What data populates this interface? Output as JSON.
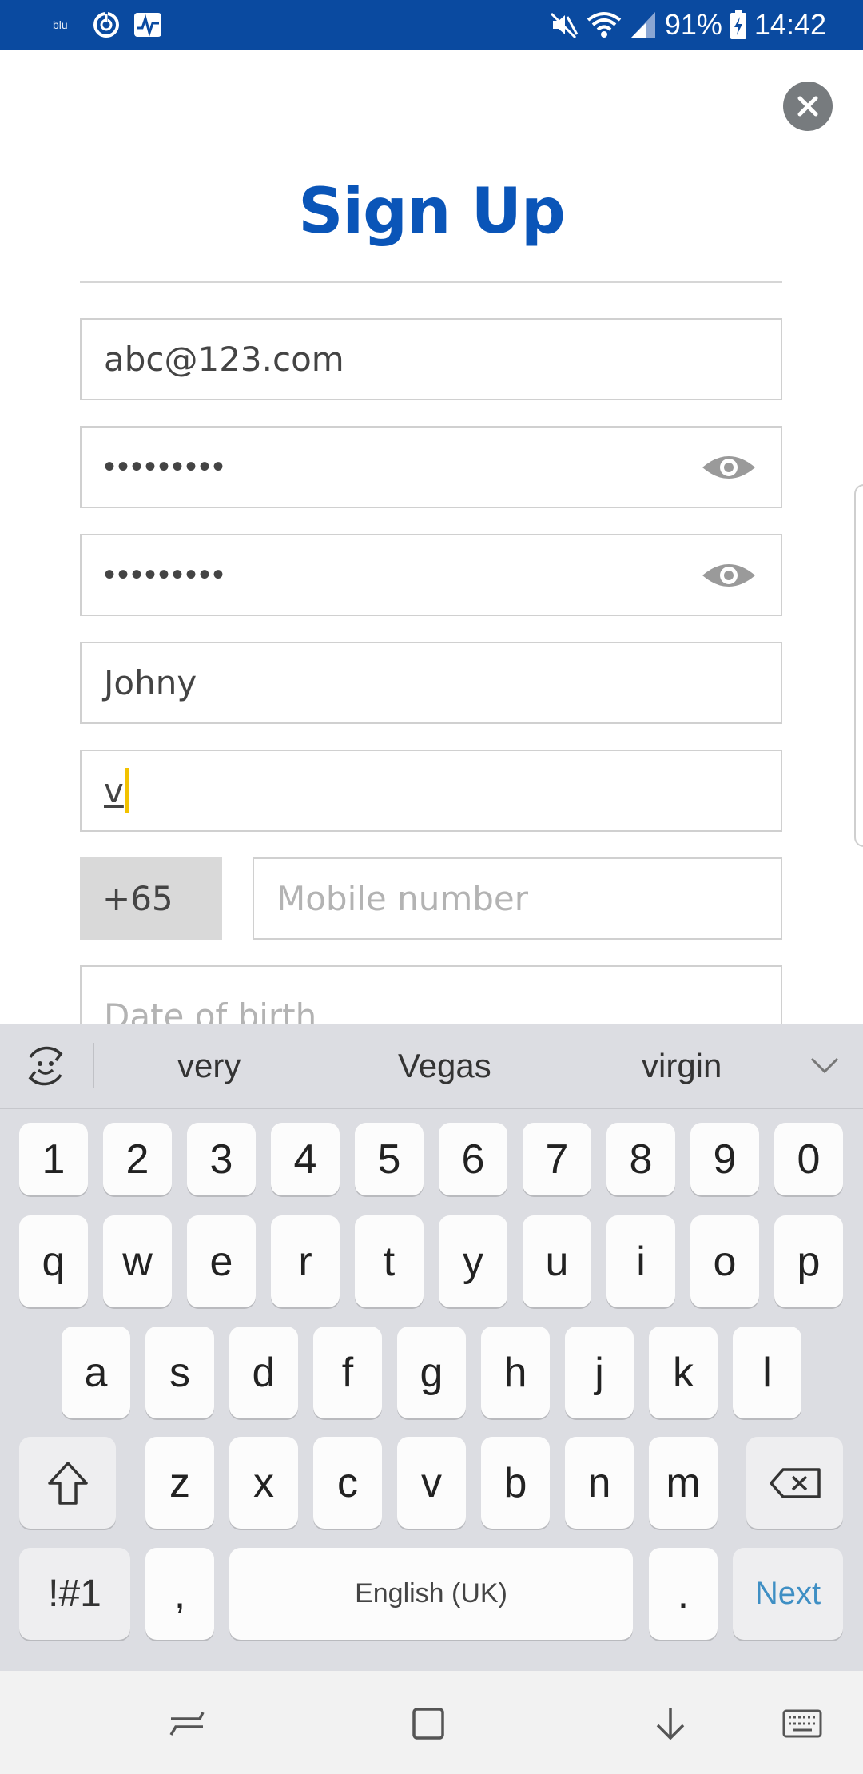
{
  "status_bar": {
    "carrier": "blu",
    "battery": "91%",
    "time": "14:42",
    "icons": [
      "power-icon",
      "activity-icon",
      "mute-icon",
      "wifi-icon",
      "signal-icon",
      "battery-charging-icon"
    ]
  },
  "header": {
    "title": "Sign Up",
    "close_icon": "close-icon"
  },
  "form": {
    "email": {
      "value": "abc@123.com"
    },
    "password": {
      "masked": "•••••••••",
      "toggle_icon": "eye-icon"
    },
    "confirm_password": {
      "masked": "•••••••••",
      "toggle_icon": "eye-icon"
    },
    "first_name": {
      "value": "Johny"
    },
    "last_name": {
      "value": "v"
    },
    "country_code": "+65",
    "mobile": {
      "placeholder": "Mobile number"
    },
    "dob": {
      "placeholder": "Date of birth"
    }
  },
  "keyboard": {
    "suggestions": [
      "very",
      "Vegas",
      "virgin"
    ],
    "row_numbers": [
      "1",
      "2",
      "3",
      "4",
      "5",
      "6",
      "7",
      "8",
      "9",
      "0"
    ],
    "row_1": [
      "q",
      "w",
      "e",
      "r",
      "t",
      "y",
      "u",
      "i",
      "o",
      "p"
    ],
    "row_2": [
      "a",
      "s",
      "d",
      "f",
      "g",
      "h",
      "j",
      "k",
      "l"
    ],
    "row_3": [
      "z",
      "x",
      "c",
      "v",
      "b",
      "n",
      "m"
    ],
    "symbols_label": "!#1",
    "comma": ",",
    "space_label": "English (UK)",
    "period": ".",
    "action_label": "Next"
  },
  "colors": {
    "brand_blue": "#0a55b8",
    "status_bar": "#0a4aa0",
    "caret": "#f2c200",
    "next_key": "#3f8fc4"
  }
}
